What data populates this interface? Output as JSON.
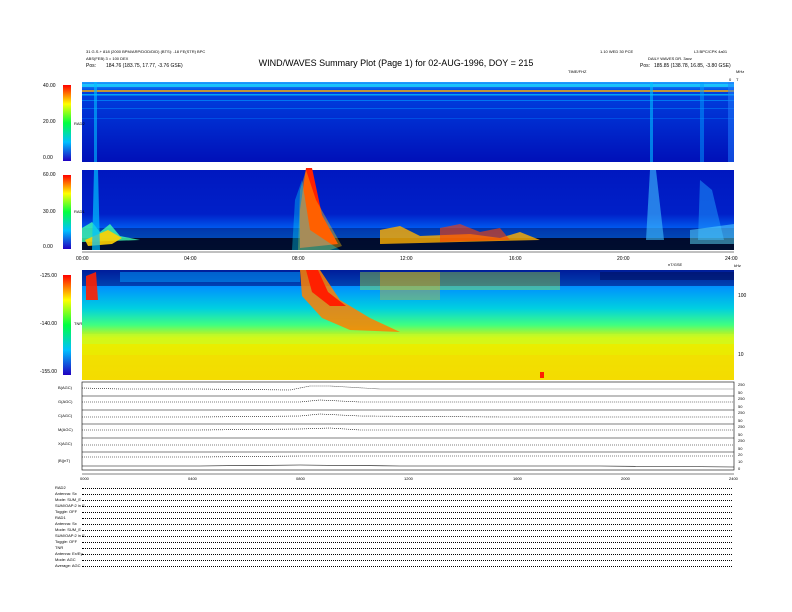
{
  "header": {
    "left_line1": "31 G.S.+ 818 (2000 BPM/ARP/DOD/DID) (BTS): -18 FE(STR) BPC",
    "left_line2": "ABS(FEB) 3 = 100 DEX",
    "left_line3_label": "Pos:",
    "left_line3_value": "184.76 (183.75, 17.77, -3.76 GSE)",
    "center_small": "TIME/FHZ",
    "right_line1_a": "1.10 WED 30 PCE",
    "right_line1_b": "L3 BPC/CPK 4a01",
    "right_line2": "DAILY WAVES DR. 3avz",
    "right_line3_label": "Pos:",
    "right_line3_value": "185.85 (138.78, 16.85, -3.80 GSE)"
  },
  "title": "WIND/WAVES Summary Plot (Page 1) for 02-AUG-1996, DOY = 215",
  "panels": {
    "rad2": {
      "label": "RAD2",
      "ticks": [
        "40.00",
        "20.00",
        "0.00"
      ]
    },
    "rad1": {
      "label": "RAD1",
      "ticks": [
        "60.00",
        "30.00",
        "0.00"
      ]
    },
    "tnr": {
      "label": "TNR",
      "ticks": [
        "-125.00",
        "-140.00",
        "-155.00"
      ],
      "right_ticks": [
        "100",
        "10"
      ],
      "right_unit": "kHz"
    }
  },
  "right_top_labels": {
    "top": "MHz",
    "upper": "T",
    "zero": "0"
  },
  "time_axis": {
    "labels": [
      "00:00",
      "04:00",
      "08:00",
      "12:00",
      "16:00",
      "20:00",
      "24:00"
    ],
    "right_label": "nT/GSE"
  },
  "time_axis_bottom": {
    "labels": [
      "0000",
      "0400",
      "0800",
      "1200",
      "1600",
      "2000",
      "2400"
    ]
  },
  "line_panels": [
    {
      "label": "B(AGC)",
      "right_ticks": [
        "250",
        "50"
      ]
    },
    {
      "label": "G(AGC)",
      "right_ticks": [
        "250",
        "50"
      ]
    },
    {
      "label": "C(AGC)",
      "right_ticks": [
        "250",
        "50"
      ]
    },
    {
      "label": "M(AGC)",
      "right_ticks": [
        "250",
        "50"
      ]
    },
    {
      "label": "X(AGC)",
      "right_ticks": [
        "250",
        "50"
      ]
    },
    {
      "label": "|B|(nT)",
      "right_ticks": [
        "20",
        "10",
        "0"
      ]
    }
  ],
  "footer_labels": [
    "RAD2",
    "Antenna:  Sx",
    "Mode:  SUM_E",
    "SUM/OAP:2 in E",
    "Toggle:  OFF",
    "RAD1",
    "Antenna:  Sx",
    "Mode:  SUM_E",
    "SUM/OAP:2 in E",
    "Toggle:  OFF",
    "TNR",
    "Antenna:  Ex/Ey",
    "Mode:  AGC",
    "Average:  AGC"
  ],
  "colors": {
    "background": "#0000c8",
    "burst": "#ff2000",
    "tnr_base": "#f0e800"
  },
  "chart_data": [
    {
      "type": "heatmap",
      "title": "RAD2",
      "ylabel": "RAD2",
      "xlim": [
        0,
        24
      ],
      "ylim": [
        0,
        40
      ],
      "yticks": [
        40,
        20,
        0
      ],
      "xticks": [
        "00:00",
        "04:00",
        "08:00",
        "12:00",
        "16:00",
        "20:00",
        "24:00"
      ]
    },
    {
      "type": "heatmap",
      "title": "RAD1",
      "ylabel": "RAD1",
      "xlim": [
        0,
        24
      ],
      "ylim": [
        0,
        60
      ],
      "yticks": [
        60,
        30,
        0
      ],
      "bursts": [
        {
          "start_hour": 8.0,
          "end_hour": 9.2,
          "peak_hour": 8.3
        }
      ]
    },
    {
      "type": "heatmap",
      "title": "TNR",
      "ylabel": "TNR",
      "ylim": [
        -155,
        -125
      ],
      "yticks": [
        -125,
        -140,
        -155
      ],
      "xlim": [
        0,
        24
      ]
    },
    {
      "type": "line",
      "series": [
        {
          "name": "B(AGC)"
        },
        {
          "name": "G(AGC)"
        },
        {
          "name": "C(AGC)"
        },
        {
          "name": "M(AGC)"
        },
        {
          "name": "X(AGC)"
        },
        {
          "name": "|B|(nT)"
        }
      ],
      "xticks": [
        "0000",
        "0400",
        "0800",
        "1200",
        "1600",
        "2000",
        "2400"
      ]
    }
  ]
}
